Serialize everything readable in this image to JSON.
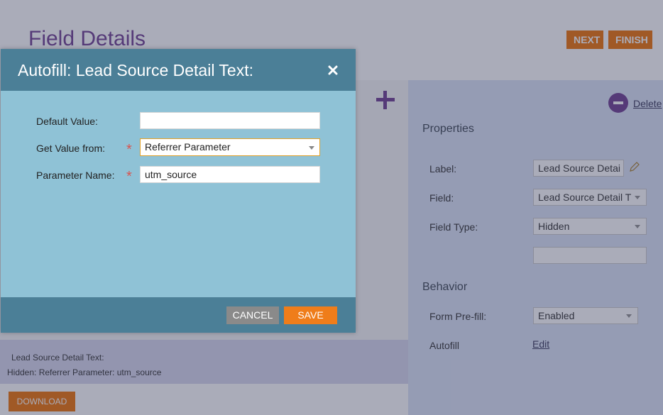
{
  "page": {
    "title": "Field Details",
    "next_label": "NEXT",
    "finish_label": "FINISH",
    "download_label": "DOWNLOAD",
    "preview": {
      "line1": "Lead Source Detail Text:",
      "line2": "Hidden: Referrer Parameter: utm_source"
    }
  },
  "properties": {
    "delete_label": "Delete",
    "section_properties": "Properties",
    "label_label": "Label:",
    "label_value": "Lead Source Detai",
    "field_label": "Field:",
    "field_value": "Lead Source Detail T",
    "field_type_label": "Field Type:",
    "field_type_value": "Hidden",
    "extra_value": "",
    "section_behavior": "Behavior",
    "prefill_label": "Form Pre-fill:",
    "prefill_value": "Enabled",
    "autofill_label": "Autofill",
    "autofill_edit": "Edit"
  },
  "modal": {
    "title": "Autofill: Lead Source Detail Text:",
    "default_value_label": "Default Value:",
    "default_value": "",
    "get_value_label": "Get Value from:",
    "get_value_selected": "Referrer Parameter",
    "param_name_label": "Parameter Name:",
    "param_name_value": "utm_source",
    "cancel_label": "CANCEL",
    "save_label": "SAVE",
    "required_mark": "*"
  },
  "colors": {
    "accent_orange": "#ef7d1a",
    "modal_header": "#4b7f97",
    "modal_body": "#8fc2d6",
    "brand_purple": "#7b4e9a"
  }
}
